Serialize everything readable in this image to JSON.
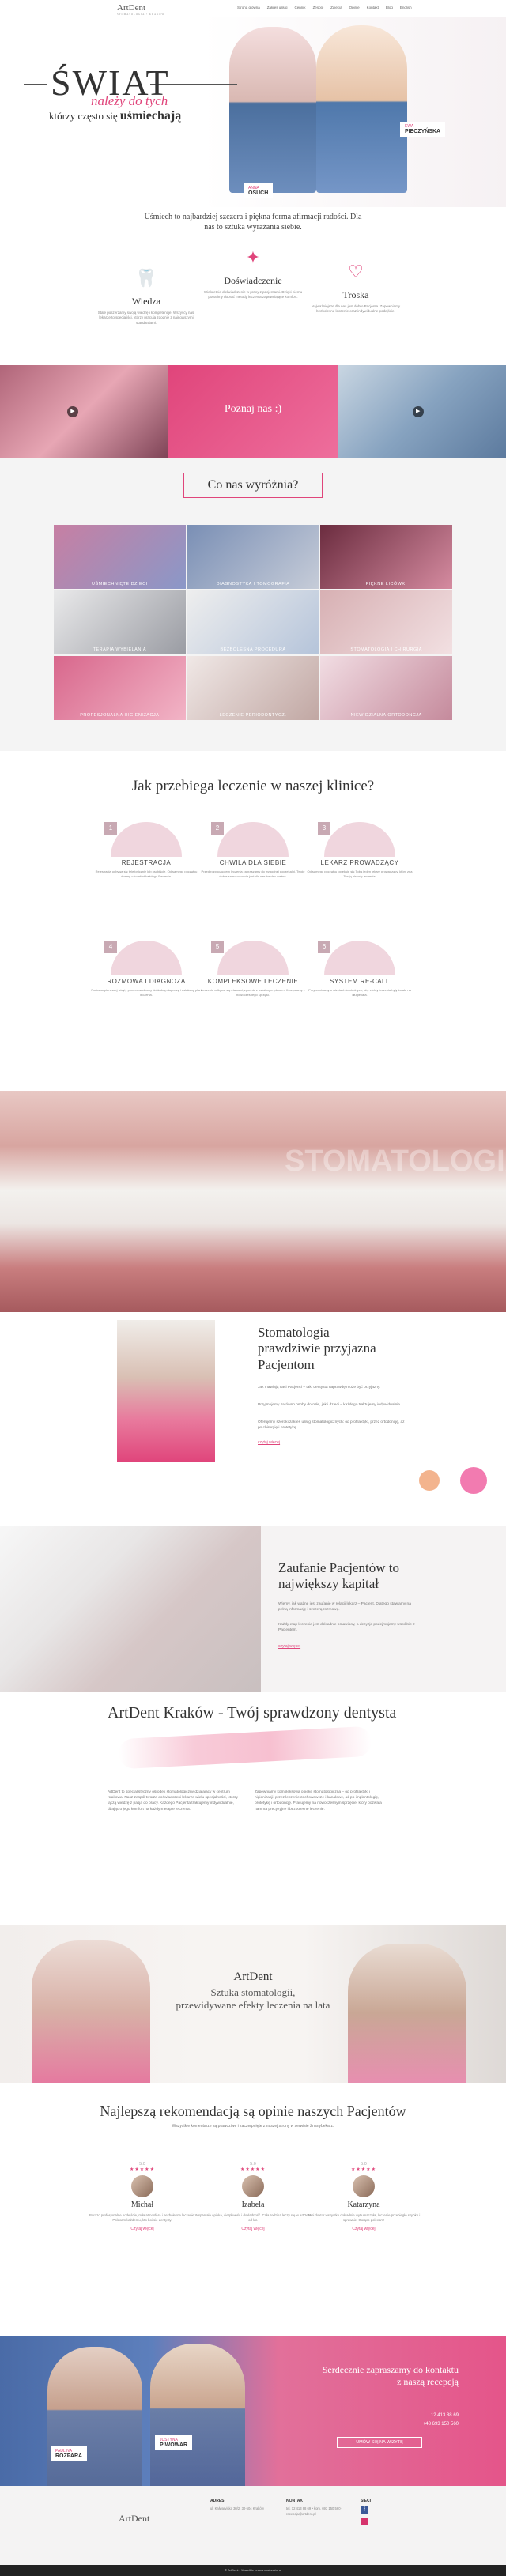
{
  "header": {
    "logo": "ArtDent",
    "logo_sub": "STOMATOLOGIA • KRAKÓW",
    "nav": [
      "Strona główna",
      "Zakres usług",
      "Cennik",
      "Zespół",
      "Zdjęcia",
      "Opinie",
      "Kontakt",
      "Blog",
      "English"
    ]
  },
  "hero": {
    "title": "ŚWIAT",
    "sub1": "należy do tych",
    "sub2_prefix": "którzy często się",
    "sub2_bold": "uśmiechają",
    "tag_left_name": "ANNA",
    "tag_left_surname": "OSUCH",
    "tag_right_name": "EWA",
    "tag_right_surname": "PIECZYŃSKA"
  },
  "intro": {
    "text": "Uśmiech to najbardziej szczera i piękna forma afirmacji radości. Dla nas to sztuka wyrażania siebie.",
    "features": [
      {
        "title": "Wiedza",
        "icon": "tooth-icon",
        "text": "Stale poszerzamy swoją wiedzę i kompetencje. Wszyscy nasi lekarze to specjaliści, którzy pracują zgodnie z najnowszymi standardami."
      },
      {
        "title": "Doświadczenie",
        "icon": "tooth-care-icon",
        "text": "Wieloletnie doświadczenie w pracy z pacjentami. Dzięki niemu potrafimy dobrać metody leczenia zapewniające komfort."
      },
      {
        "title": "Troska",
        "icon": "heart-icon",
        "text": "Najważniejsze dla nas jest dobro Pacjenta. Zapewniamy bezbolesne leczenie oraz indywidualne podejście."
      }
    ]
  },
  "strip": {
    "poznaj": "Poznaj nas :)"
  },
  "wyr": {
    "title": "Co nas wyróżnia?",
    "items": [
      "UŚMIECHNIĘTE DZIECI",
      "DIAGNOSTYKA I TOMOGRAFIA",
      "PIĘKNE LICÓWKI",
      "TERAPIA WYBIELANIA",
      "BEZBOLESNA PROCEDURA",
      "STOMATOLOGIA I CHIRURGIA",
      "PROFESJONALNA HIGIENIZACJA",
      "LECZENIE PERIODONTYCZ.",
      "NIEWIDZIALNA ORTODONCJA"
    ]
  },
  "proc": {
    "title": "Jak przebiega leczenie w naszej klinice?",
    "steps": [
      {
        "n": "1",
        "title": "REJESTRACJA",
        "text": "Rejestracja odbywa się telefonicznie lub osobiście. Od samego początku dbamy o komfort każdego Pacjenta."
      },
      {
        "n": "2",
        "title": "CHWILA DLA SIEBIE",
        "text": "Przed rozpoczęciem leczenia zapraszamy do wygodnej poczekalni. Twoje dobre samopoczucie jest dla nas bardzo ważne."
      },
      {
        "n": "3",
        "title": "LEKARZ PROWADZĄCY",
        "text": "Od samego początku opiekuje się Tobą jeden lekarz prowadzący, który zna Twoją historię leczenia."
      },
      {
        "n": "4",
        "title": "ROZMOWA I DIAGNOZA",
        "text": "Podczas pierwszej wizyty przeprowadzamy dokładną diagnozę i ustalamy plan leczenia."
      },
      {
        "n": "5",
        "title": "KOMPLEKSOWE LECZENIE",
        "text": "Leczenie odbywa się etapami, zgodnie z ustalonym planem. Korzystamy z nowoczesnego sprzętu."
      },
      {
        "n": "6",
        "title": "SYSTEM RE-CALL",
        "text": "Przypominamy o wizytach kontrolnych, aby efekty leczenia były trwałe na długie lata."
      }
    ]
  },
  "teeth": {
    "word": "STOMATOLOGIA"
  },
  "stom": {
    "title_1": "Stomatologia",
    "title_2": "prawdziwie przyjazna",
    "title_3": "Pacjentom",
    "p1": "Jak mawiają nasi Pacjenci – tak, dentysta naprawdę może być przyjazny.",
    "p2": "Przyjmujemy zarówno osoby dorosłe, jak i dzieci – każdego traktujemy indywidualnie.",
    "p3": "Oferujemy szeroki zakres usług stomatologicznych: od profilaktyki, przez ortodoncję, aż po chirurgię i protetykę.",
    "more": "czytaj więcej"
  },
  "zauf": {
    "title_1": "Zaufanie Pacjentów to",
    "title_2": "największy kapitał",
    "p1": "Wiemy, jak ważne jest zaufanie w relacji lekarz – Pacjent. Dlatego stawiamy na pełną informację i szczerą rozmowę.",
    "p2": "Każdy etap leczenia jest dokładnie omawiany, a decyzje podejmujemy wspólnie z Pacjentem.",
    "more": "czytaj więcej"
  },
  "krak": {
    "title": "ArtDent Kraków - Twój sprawdzony dentysta",
    "col1": "ArtDent to specjalistyczny ośrodek stomatologiczny działający w centrum Krakowa. Nasz zespół tworzą doświadczeni lekarze wielu specjalności, którzy łączą wiedzę z pasją do pracy. Każdego Pacjenta traktujemy indywidualnie, dbając o jego komfort na każdym etapie leczenia.",
    "col2": "Zapewniamy kompleksową opiekę stomatologiczną – od profilaktyki i higienizacji, przez leczenie zachowawcze i kanałowe, aż po implantologię, protetykę i ortodoncję. Pracujemy na nowoczesnym sprzęcie, który pozwala nam na precyzyjne i bezbolesne leczenie."
  },
  "mask": {
    "title": "ArtDent",
    "sub_1": "Sztuka stomatologii,",
    "sub_2": "przewidywane efekty leczenia na lata"
  },
  "rev": {
    "title": "Najlepszą rekomendacją są opinie naszych Pacjentów",
    "sub": "Wszystkie komentarze są prawdziwe i zaczerpnięte z naszej strony w serwisie ZnanyLekarz.",
    "items": [
      {
        "score": "5.0",
        "stars": "★★★★★",
        "name": "Michał",
        "text": "Bardzo profesjonalne podejście, miła atmosfera i bezbolesne leczenie. Polecam każdemu, kto boi się dentysty.",
        "more": "Czytaj więcej"
      },
      {
        "score": "5.0",
        "stars": "★★★★★",
        "name": "Izabela",
        "text": "Wspaniała opieka, cierpliwość i dokładność. Cała rodzina leczy się w ArtDent od lat.",
        "more": "Czytaj więcej"
      },
      {
        "score": "5.0",
        "stars": "★★★★★",
        "name": "Katarzyna",
        "text": "Pani doktor wszystko dokładnie wytłumaczyła, leczenie przebiegło szybko i sprawnie. Gorąco polecam!",
        "more": "Czytaj więcej"
      }
    ]
  },
  "contact": {
    "title": "Serdecznie zapraszamy do kontaktu z naszą recepcją",
    "phone1": "12 413 88 69",
    "phone2": "+48 693 150 560",
    "button": "UMÓW SIĘ NA WIZYTĘ",
    "tag1_name": "PAULINA",
    "tag1_surname": "ROZPARA",
    "tag2_name": "JUSTYNA",
    "tag2_surname": "PIWOWAR"
  },
  "footer": {
    "logo": "ArtDent",
    "adres_h": "ADRES",
    "adres": "ul. Kalwaryjska 30/2, 30-504 Kraków",
    "kontakt_h": "KONTAKT",
    "kontakt": "tel. 12 413 88 69 • kom. 693 150 560 • recepcja@artdent.pl",
    "social_h": "SIECI",
    "copyright": "© ArtDent • Wszelkie prawa zastrzeżone"
  },
  "colors": {
    "accent": "#e0457b",
    "soft_pink": "#f0d6de",
    "blue": "#4a6ba7"
  }
}
